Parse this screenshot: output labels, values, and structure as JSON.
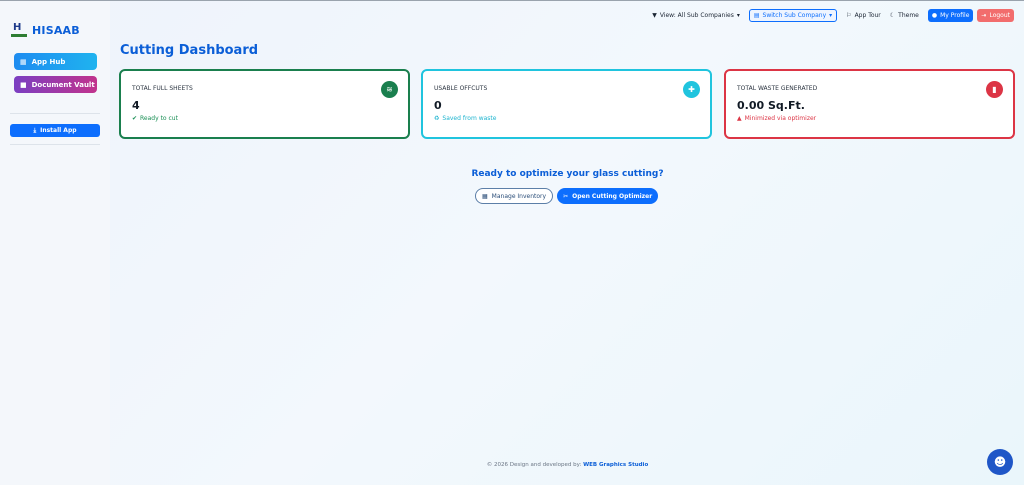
{
  "brand": {
    "name": "HISAAB",
    "logo_letter": "H"
  },
  "sidebar": {
    "app_hub": "App Hub",
    "document_vault": "Document Vault",
    "install_app": "Install App"
  },
  "topbar": {
    "view_filter": "View: All Sub Companies",
    "switch_company": "Switch Sub Company",
    "app_tour": "App Tour",
    "theme": "Theme",
    "my_profile": "My Profile",
    "logout": "Logout"
  },
  "page": {
    "title": "Cutting Dashboard"
  },
  "cards": [
    {
      "label": "TOTAL FULL SHEETS",
      "value": "4",
      "sub": "Ready to cut",
      "icon": "layers-icon",
      "color": "#1a7f4e"
    },
    {
      "label": "USABLE OFFCUTS",
      "value": "0",
      "sub": "Saved from waste",
      "icon": "puzzle-icon",
      "color": "#20c4de"
    },
    {
      "label": "TOTAL WASTE GENERATED",
      "value": "0.00 Sq.Ft.",
      "sub": "Minimized via optimizer",
      "icon": "trash-icon",
      "color": "#dc3545"
    }
  ],
  "cta": {
    "title": "Ready to optimize your glass cutting?",
    "manage_inventory": "Manage Inventory",
    "open_optimizer": "Open Cutting Optimizer"
  },
  "footer": {
    "text": "© 2026 Design and developed by:",
    "link": "WEB Graphics Studio"
  },
  "colors": {
    "primary": "#0d6efd",
    "success": "#1a7f4e",
    "info": "#20c4de",
    "danger": "#dc3545"
  }
}
